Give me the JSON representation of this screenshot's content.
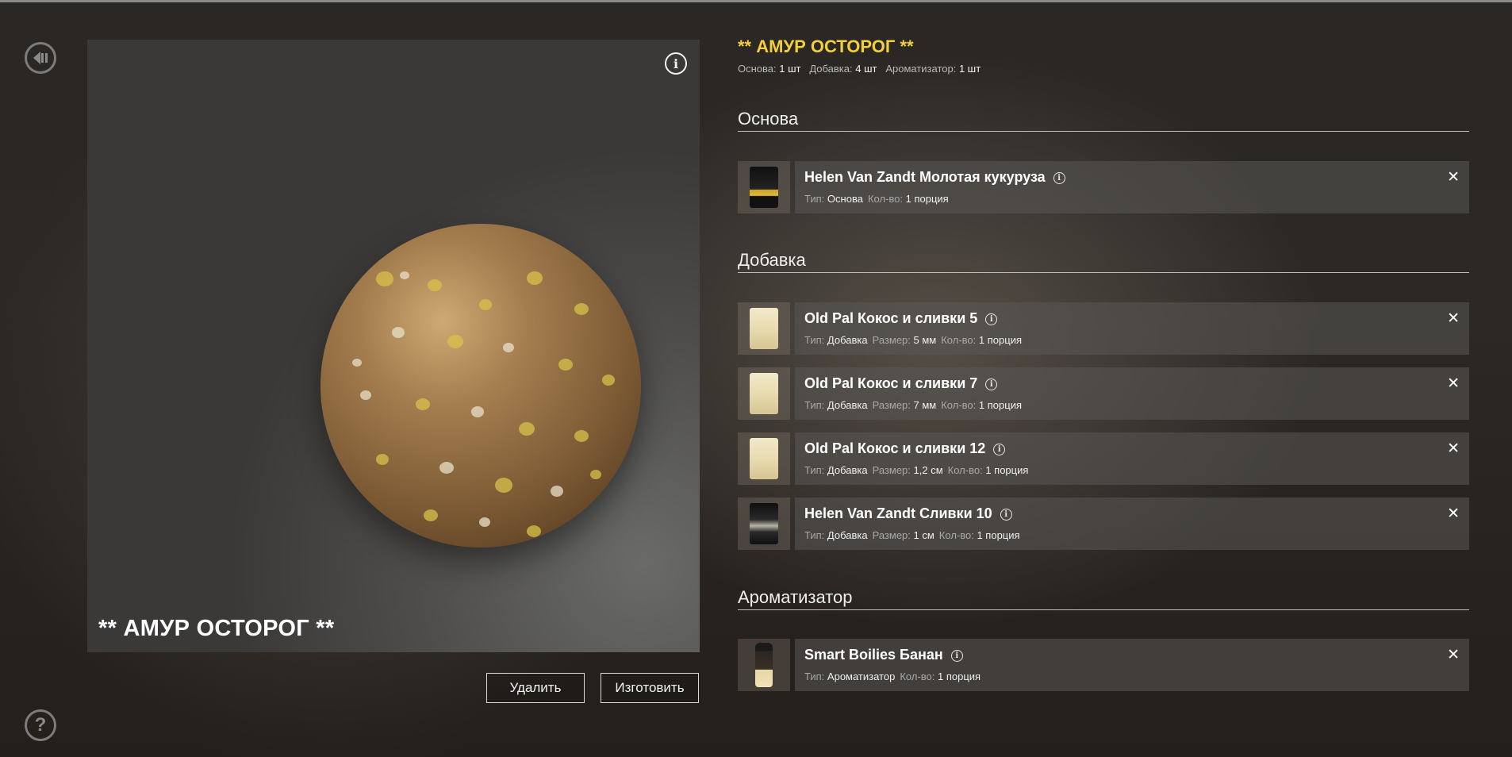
{
  "nav": {
    "back_icon": "back-arrow-icon",
    "help_icon": "help-icon",
    "help_glyph": "?"
  },
  "preview": {
    "title": "** АМУР ОСТОРОГ **",
    "info_glyph": "i",
    "ball_colors": {
      "base": "#a9773f",
      "spots": "#d8c24a",
      "flecks": "#e8e0c8"
    }
  },
  "actions": {
    "delete_label": "Удалить",
    "make_label": "Изготовить"
  },
  "recipe": {
    "title": "** АМУР ОСТОРОГ **",
    "summary": {
      "base_label": "Основа:",
      "base_value": "1 шт",
      "additive_label": "Добавка:",
      "additive_value": "4 шт",
      "flavor_label": "Ароматизатор:",
      "flavor_value": "1 шт"
    }
  },
  "sections": {
    "base": {
      "title": "Основа",
      "items": [
        {
          "name": "Helen Van Zandt Молотая кукуруза",
          "type_label": "Тип:",
          "type": "Основа",
          "qty_label": "Кол-во:",
          "qty": "1 порция",
          "thumb": "dark"
        }
      ]
    },
    "additive": {
      "title": "Добавка",
      "items": [
        {
          "name": "Old Pal Кокос и сливки 5",
          "type_label": "Тип:",
          "type": "Добавка",
          "size_label": "Размер:",
          "size": "5 мм",
          "qty_label": "Кол-во:",
          "qty": "1 порция",
          "thumb": "light"
        },
        {
          "name": "Old Pal Кокос и сливки 7",
          "type_label": "Тип:",
          "type": "Добавка",
          "size_label": "Размер:",
          "size": "7 мм",
          "qty_label": "Кол-во:",
          "qty": "1 порция",
          "thumb": "light"
        },
        {
          "name": "Old Pal Кокос и сливки 12",
          "type_label": "Тип:",
          "type": "Добавка",
          "size_label": "Размер:",
          "size": "1,2 см",
          "qty_label": "Кол-во:",
          "qty": "1 порция",
          "thumb": "light"
        },
        {
          "name": "Helen Van Zandt Сливки 10",
          "type_label": "Тип:",
          "type": "Добавка",
          "size_label": "Размер:",
          "size": "1 см",
          "qty_label": "Кол-во:",
          "qty": "1 порция",
          "thumb": "darkcream"
        }
      ]
    },
    "flavor": {
      "title": "Ароматизатор",
      "items": [
        {
          "name": "Smart Boilies Банан",
          "type_label": "Тип:",
          "type": "Ароматизатор",
          "qty_label": "Кол-во:",
          "qty": "1 порция",
          "thumb": "bottle"
        }
      ]
    }
  },
  "glyphs": {
    "info_small": "i",
    "close": "✕"
  }
}
